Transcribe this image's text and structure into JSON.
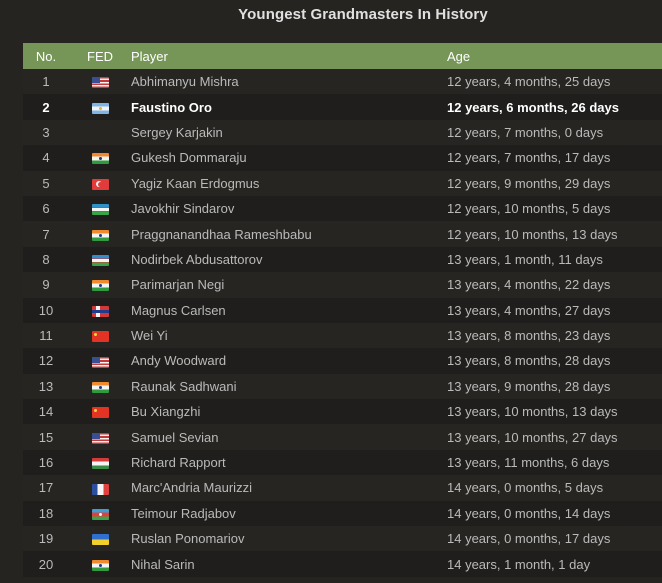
{
  "title": "Youngest Grandmasters In History",
  "columns": {
    "no": "No.",
    "fed": "FED",
    "player": "Player",
    "age": "Age"
  },
  "colors": {
    "header": "#759656",
    "background": "#262421",
    "row_odd": "#272522",
    "row_even": "#1f1e1c"
  },
  "rows": [
    {
      "no": "1",
      "fed": "us-flag",
      "player": "Abhimanyu Mishra",
      "age": "12 years, 4 months, 25 days",
      "bold": false
    },
    {
      "no": "2",
      "fed": "ar-flag",
      "player": "Faustino Oro",
      "age": "12 years, 6 months, 26 days",
      "bold": true
    },
    {
      "no": "3",
      "fed": "",
      "player": "Sergey Karjakin",
      "age": "12 years, 7 months, 0 days",
      "bold": false
    },
    {
      "no": "4",
      "fed": "in-flag",
      "player": "Gukesh Dommaraju",
      "age": "12 years, 7 months, 17 days",
      "bold": false
    },
    {
      "no": "5",
      "fed": "tr-flag",
      "player": "Yagiz Kaan Erdogmus",
      "age": "12 years, 9 months, 29 days",
      "bold": false
    },
    {
      "no": "6",
      "fed": "uz-flag",
      "player": "Javokhir Sindarov",
      "age": "12 years, 10 months, 5 days",
      "bold": false
    },
    {
      "no": "7",
      "fed": "in-flag",
      "player": "Praggnanandhaa Rameshbabu",
      "age": "12 years, 10 months, 13 days",
      "bold": false
    },
    {
      "no": "8",
      "fed": "uz-flag",
      "player": "Nodirbek Abdusattorov",
      "age": "13 years, 1 month, 11 days",
      "bold": false
    },
    {
      "no": "9",
      "fed": "in-flag",
      "player": "Parimarjan Negi",
      "age": "13 years, 4 months, 22 days",
      "bold": false
    },
    {
      "no": "10",
      "fed": "no-flag",
      "player": "Magnus Carlsen",
      "age": "13 years, 4 months, 27 days",
      "bold": false
    },
    {
      "no": "11",
      "fed": "cn-flag",
      "player": "Wei Yi",
      "age": "13 years, 8 months, 23 days",
      "bold": false
    },
    {
      "no": "12",
      "fed": "us-flag",
      "player": "Andy Woodward",
      "age": "13 years, 8 months, 28 days",
      "bold": false
    },
    {
      "no": "13",
      "fed": "in-flag",
      "player": "Raunak Sadhwani",
      "age": "13 years, 9 months, 28 days",
      "bold": false
    },
    {
      "no": "14",
      "fed": "cn-flag",
      "player": "Bu Xiangzhi",
      "age": "13 years, 10 months, 13 days",
      "bold": false
    },
    {
      "no": "15",
      "fed": "us-flag",
      "player": "Samuel Sevian",
      "age": "13 years, 10 months, 27 days",
      "bold": false
    },
    {
      "no": "16",
      "fed": "hu-flag",
      "player": "Richard Rapport",
      "age": "13 years, 11 months, 6 days",
      "bold": false
    },
    {
      "no": "17",
      "fed": "fr-flag",
      "player": "Marc'Andria Maurizzi",
      "age": "14 years, 0 months, 5 days",
      "bold": false
    },
    {
      "no": "18",
      "fed": "az-flag",
      "player": "Teimour Radjabov",
      "age": "14 years, 0 months, 14 days",
      "bold": false
    },
    {
      "no": "19",
      "fed": "ua-flag",
      "player": "Ruslan Ponomariov",
      "age": "14 years, 0 months, 17 days",
      "bold": false
    },
    {
      "no": "20",
      "fed": "in-flag",
      "player": "Nihal Sarin",
      "age": "14 years, 1 month, 1 day",
      "bold": false
    }
  ]
}
